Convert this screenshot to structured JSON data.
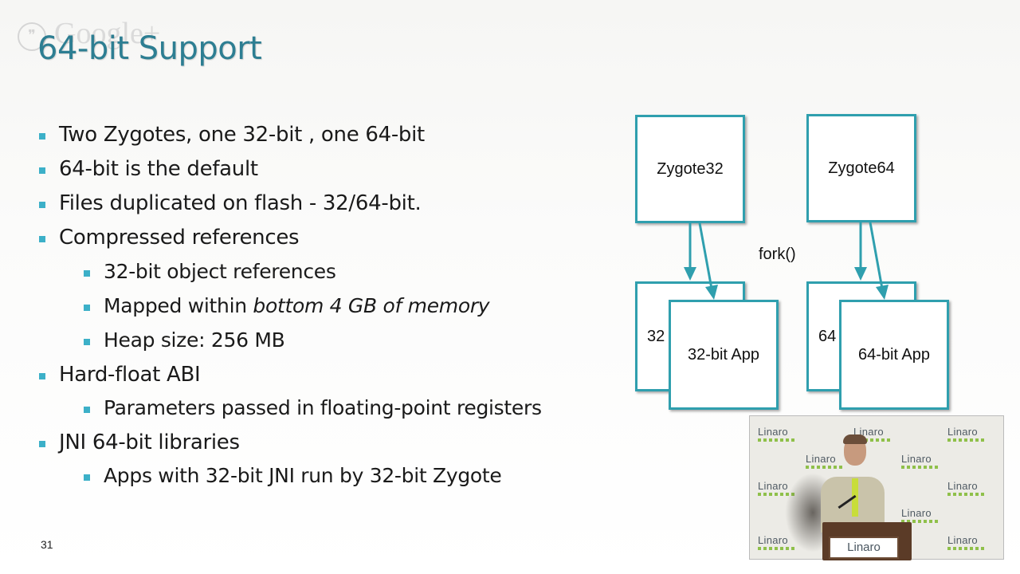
{
  "overlay": {
    "logo_text": "Google+"
  },
  "slide": {
    "title": "64-bit Support",
    "number": "31",
    "bullets": [
      {
        "level": 1,
        "text": "Two Zygotes, one 32-bit , one 64-bit"
      },
      {
        "level": 1,
        "text": "64-bit is the default"
      },
      {
        "level": 1,
        "text": "Files duplicated on flash - 32/64-bit."
      },
      {
        "level": 1,
        "text": "Compressed references"
      },
      {
        "level": 2,
        "text": "32-bit object references"
      },
      {
        "level": 2,
        "text_plain": "Mapped within ",
        "text_italic": "bottom 4 GB of memory"
      },
      {
        "level": 2,
        "text": "Heap size:  256 MB"
      },
      {
        "level": 1,
        "text": "Hard-float ABI"
      },
      {
        "level": 2,
        "text": "Parameters passed in floating-point registers"
      },
      {
        "level": 1,
        "text": "JNI 64-bit libraries"
      },
      {
        "level": 2,
        "text": "Apps with 32-bit JNI run by 32-bit Zygote"
      }
    ]
  },
  "diagram": {
    "zygote32": "Zygote32",
    "zygote64": "Zygote64",
    "fork_label": "fork()",
    "back32": "32",
    "back64": "64",
    "app32": "32-bit App",
    "app64": "64-bit App",
    "box_color": "#2f9fae",
    "arrow_color": "#2f9fae"
  },
  "webcam": {
    "watermark": "Linaro",
    "podium_sign": "Linaro"
  },
  "colors": {
    "title": "#2d7e92",
    "bullet_marker": "#3cb0c8"
  }
}
